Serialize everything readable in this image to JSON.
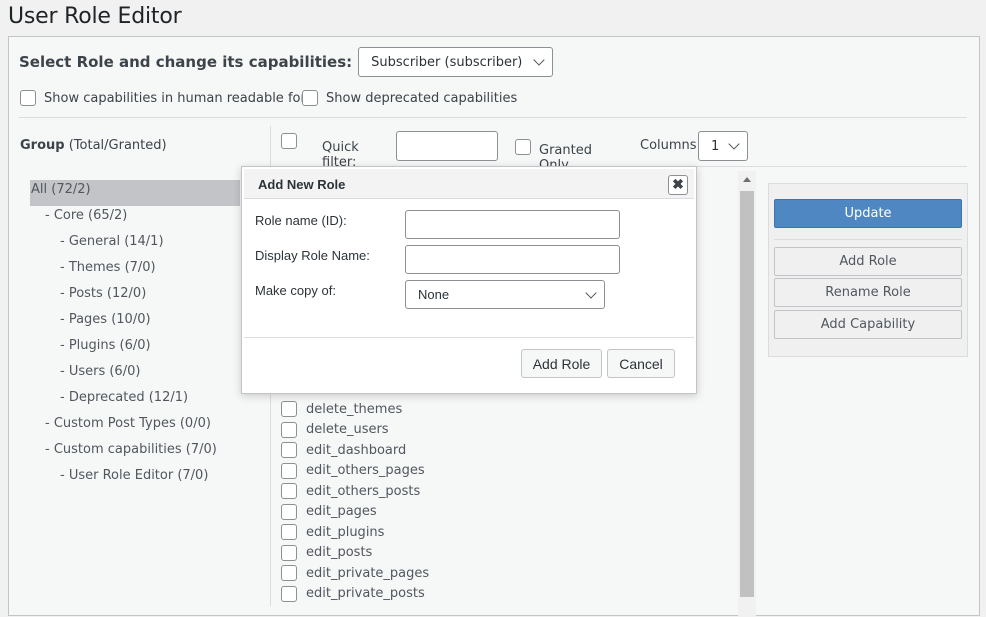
{
  "page": {
    "title": "User Role Editor"
  },
  "role_select": {
    "label": "Select Role and change its capabilities:",
    "value": "Subscriber (subscriber)"
  },
  "options": {
    "human_readable": "Show capabilities in human readable form",
    "deprecated": "Show deprecated capabilities"
  },
  "group_header": {
    "bold": "Group",
    "rest": " (Total/Granted)"
  },
  "filter": {
    "quick_filter_label": "Quick filter:",
    "quick_filter_value": "",
    "granted_only": "Granted Only",
    "columns_label": "Columns:",
    "columns_value": "1"
  },
  "tree": [
    {
      "label": "All (72/2)",
      "indent": 0,
      "selected": true
    },
    {
      "label": "- Core (65/2)",
      "indent": 1
    },
    {
      "label": "- General (14/1)",
      "indent": 2
    },
    {
      "label": "- Themes (7/0)",
      "indent": 2
    },
    {
      "label": "- Posts (12/0)",
      "indent": 2
    },
    {
      "label": "- Pages (10/0)",
      "indent": 2
    },
    {
      "label": "- Plugins (6/0)",
      "indent": 2
    },
    {
      "label": "- Users (6/0)",
      "indent": 2
    },
    {
      "label": "- Deprecated (12/1)",
      "indent": 2
    },
    {
      "label": "- Custom Post Types (0/0)",
      "indent": 1
    },
    {
      "label": "- Custom capabilities (7/0)",
      "indent": 1
    },
    {
      "label": "- User Role Editor (7/0)",
      "indent": 2
    }
  ],
  "capabilities": [
    "delete_themes",
    "delete_users",
    "edit_dashboard",
    "edit_others_pages",
    "edit_others_posts",
    "edit_pages",
    "edit_plugins",
    "edit_posts",
    "edit_private_pages",
    "edit_private_posts"
  ],
  "actions": {
    "update": "Update",
    "add_role": "Add Role",
    "rename_role": "Rename Role",
    "add_capability": "Add Capability"
  },
  "colors": {
    "primary": "#4f87c2",
    "selected_tree": "#c3c4c7"
  },
  "modal": {
    "title": "Add New Role",
    "close_symbol": "✖",
    "role_name_label": "Role name (ID):",
    "role_name_value": "",
    "display_name_label": "Display Role Name:",
    "display_name_value": "",
    "copy_label": "Make copy of:",
    "copy_value": "None",
    "add_button": "Add Role",
    "cancel_button": "Cancel"
  }
}
